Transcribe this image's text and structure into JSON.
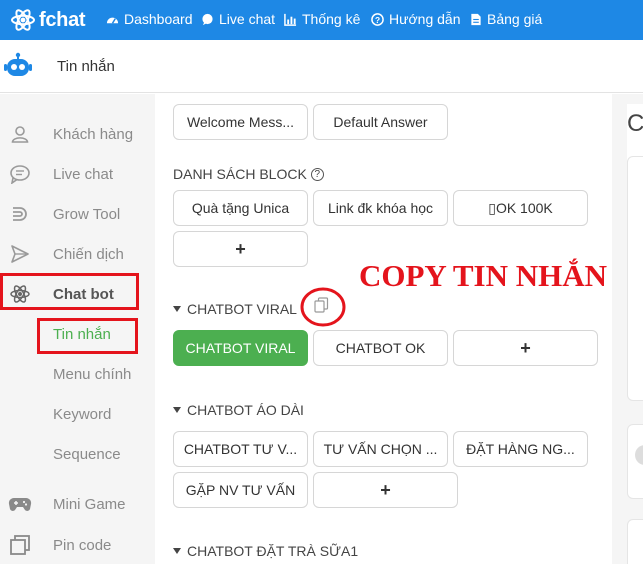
{
  "brand": {
    "name": "fchat"
  },
  "nav": [
    {
      "label": "Dashboard",
      "icon": "dashboard-icon"
    },
    {
      "label": "Live chat",
      "icon": "chat-bubble-icon"
    },
    {
      "label": "Thống kê",
      "icon": "bar-chart-icon"
    },
    {
      "label": "Hướng dẫn",
      "icon": "help-circle-icon"
    },
    {
      "label": "Bảng giá",
      "icon": "document-icon"
    }
  ],
  "header": {
    "title": "Tin nhắn"
  },
  "sidebar": {
    "items": [
      {
        "label": "Khách hàng",
        "icon": "user-icon"
      },
      {
        "label": "Live chat",
        "icon": "chat-icon"
      },
      {
        "label": "Grow Tool",
        "icon": "magnet-icon"
      },
      {
        "label": "Chiến dịch",
        "icon": "send-icon"
      },
      {
        "label": "Chat bot",
        "icon": "atom-icon"
      },
      {
        "label": "Mini Game",
        "icon": "gamepad-icon"
      },
      {
        "label": "Pin code",
        "icon": "copy-icon"
      }
    ],
    "chatbot_sub": [
      "Tin nhắn",
      "Menu chính",
      "Keyword",
      "Sequence"
    ]
  },
  "main": {
    "top_buttons": [
      "Welcome Mess...",
      "Default Answer"
    ],
    "block_list": {
      "title": "DANH SÁCH BLOCK",
      "help_icon": "?",
      "buttons": [
        "Quà tặng Unica",
        "Link đk khóa học",
        "▯OK 100K"
      ],
      "add": "+"
    },
    "viral": {
      "title": "CHATBOT VIRAL",
      "buttons": [
        "CHATBOT VIRAL",
        "CHATBOT OK"
      ],
      "add": "+"
    },
    "aodai": {
      "title": "CHATBOT ÁO DÀI",
      "buttons": [
        "CHATBOT TƯ V...",
        "TƯ VẤN CHỌN ...",
        "ĐẶT HÀNG NG...",
        "GẶP NV TƯ VẤN"
      ],
      "add": "+"
    },
    "trasua": {
      "title": "CHATBOT ĐẶT TRÀ SỮA1"
    }
  },
  "right_panel": {
    "letter": "C"
  },
  "annotation": {
    "text": "COPY TIN NHẮN"
  },
  "colors": {
    "topbar": "#1e88e5",
    "accent_green": "#4caf50",
    "annotation_red": "#e4141c"
  }
}
